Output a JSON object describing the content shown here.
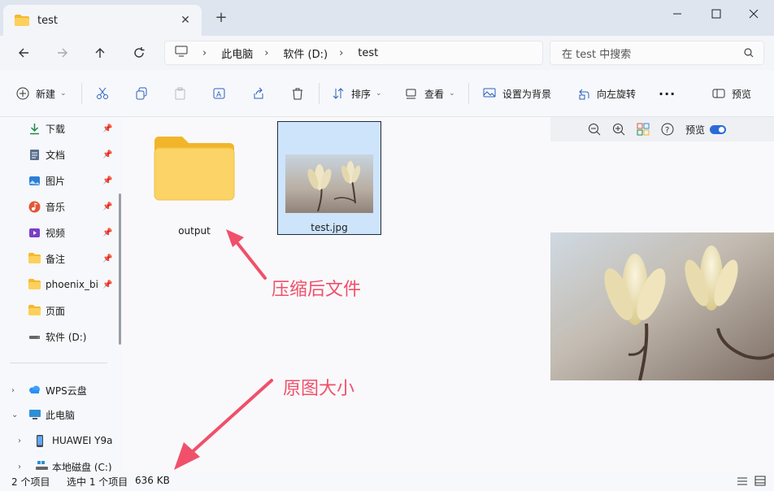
{
  "window": {
    "tab_title": "test",
    "new_tab_label": "+",
    "minimize": "—",
    "maximize": "☐",
    "close": "✕"
  },
  "address": {
    "crumbs": [
      "此电脑",
      "软件 (D:)",
      "test"
    ],
    "search_placeholder": "在 test 中搜索"
  },
  "toolbar": {
    "new_label": "新建",
    "sort_label": "排序",
    "view_label": "查看",
    "set_bg_label": "设置为背景",
    "rotate_label": "向左旋转",
    "more_label": "···",
    "preview_label": "预览"
  },
  "sidebar": {
    "quick": [
      {
        "label": "下载",
        "icon": "download-icon",
        "pinned": true
      },
      {
        "label": "文档",
        "icon": "document-icon",
        "pinned": true
      },
      {
        "label": "图片",
        "icon": "picture-icon",
        "pinned": true
      },
      {
        "label": "音乐",
        "icon": "music-icon",
        "pinned": true
      },
      {
        "label": "视频",
        "icon": "video-icon",
        "pinned": true
      },
      {
        "label": "备注",
        "icon": "folder-icon",
        "pinned": true
      },
      {
        "label": "phoenix_bir",
        "icon": "folder-icon",
        "pinned": true
      },
      {
        "label": "页面",
        "icon": "folder-icon",
        "pinned": false
      },
      {
        "label": "软件 (D:)",
        "icon": "drive-icon",
        "pinned": false
      }
    ],
    "tree": [
      {
        "label": "WPS云盘",
        "expanded": false
      },
      {
        "label": "此电脑",
        "expanded": true
      },
      {
        "label": "HUAWEI Y9a",
        "expanded": false
      },
      {
        "label": "本地磁盘 (C:)",
        "expanded": false
      }
    ]
  },
  "files": [
    {
      "name": "output",
      "type": "folder",
      "selected": false
    },
    {
      "name": "test.jpg",
      "type": "image",
      "selected": true
    }
  ],
  "preview": {
    "toggle_label": "预览",
    "toggle_on": true
  },
  "status": {
    "item_count": "2 个项目",
    "selection": "选中 1 个项目",
    "size": "636 KB"
  },
  "annotations": {
    "output_note": "压缩后文件",
    "size_note": "原图大小",
    "color": "#f0506a"
  },
  "colors": {
    "accent": "#2b6bd6",
    "selection": "#cde4fb",
    "folder": "#f7c948"
  }
}
